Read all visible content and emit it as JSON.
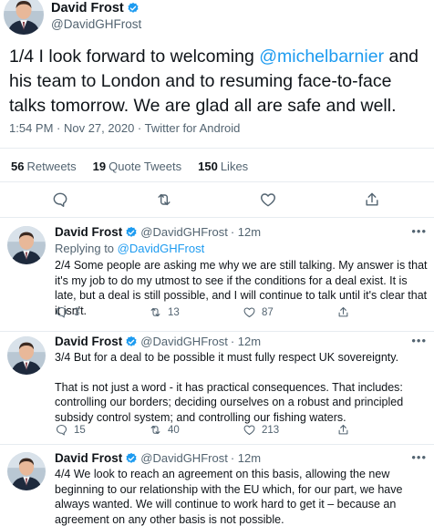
{
  "main_tweet": {
    "author_name": "David Frost",
    "author_handle": "@DavidGHFrost",
    "text_part1": "1/4 I look forward to welcoming ",
    "mention": "@michelbarnier",
    "text_part2": " and his team to London and to resuming face-to-face talks tomorrow. We are glad all are safe and well.",
    "timestamp": "1:54 PM · Nov 27, 2020 · Twitter for Android",
    "stats": {
      "retweets_count": "56",
      "retweets_label": "Retweets",
      "quotes_count": "19",
      "quotes_label": "Quote Tweets",
      "likes_count": "150",
      "likes_label": "Likes"
    }
  },
  "replies": [
    {
      "author_name": "David Frost",
      "author_handle": "@DavidGHFrost",
      "time": "· 12m",
      "replying_to_prefix": "Replying to ",
      "replying_to_handle": "@DavidGHFrost",
      "text": "2/4 Some people are asking me why we are still talking. My answer is that it's my job to do my utmost to see if the conditions for a deal exist. It is late, but a deal is still possible, and I will continue to talk until it's clear that it isn't.",
      "reply_count": "3",
      "retweet_count": "13",
      "like_count": "87"
    },
    {
      "author_name": "David Frost",
      "author_handle": "@DavidGHFrost",
      "time": "· 12m",
      "text_para1": "3/4 But for a deal to be possible it must fully respect UK sovereignty.",
      "text_para2": "That is not just a word - it has practical consequences. That includes: controlling our borders; deciding ourselves on a robust and principled subsidy control system; and controlling our fishing waters.",
      "reply_count": "15",
      "retweet_count": "40",
      "like_count": "213"
    },
    {
      "author_name": "David Frost",
      "author_handle": "@DavidGHFrost",
      "time": "· 12m",
      "text": "4/4 We look to reach an agreement on this basis, allowing the new beginning to our relationship with the EU which, for our part, we have always wanted.  We will continue to work hard to get it – because an agreement on any other basis is not possible."
    }
  ],
  "more_glyph": "•••",
  "colors": {
    "accent": "#1d9bf0",
    "text": "#0f1419",
    "secondary": "#536471",
    "divider": "#e7ecf0"
  },
  "icons": [
    "verified-badge-icon",
    "reply-icon",
    "retweet-icon",
    "like-icon",
    "share-icon",
    "more-icon"
  ]
}
